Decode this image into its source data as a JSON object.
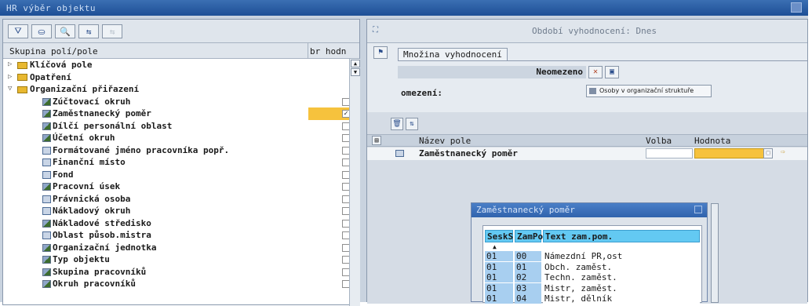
{
  "window": {
    "title": "HR výběr objektu"
  },
  "left": {
    "toolbar": [
      "⛛",
      "⛀",
      "🔍",
      "⇆",
      "⇆"
    ],
    "header": {
      "col1": "Skupina polí/pole",
      "col2": "br hodn"
    },
    "tree": [
      {
        "level": 0,
        "expand": "▷",
        "label": "Klíčová pole",
        "check": false
      },
      {
        "level": 0,
        "expand": "▷",
        "label": "Opatření",
        "check": false
      },
      {
        "level": 0,
        "expand": "▽",
        "label": "Organizační přiřazení",
        "check": false
      },
      {
        "level": 1,
        "icon": "pen",
        "label": "Zúčtovací okruh",
        "check": false
      },
      {
        "level": 1,
        "icon": "pen",
        "label": "Zaměstnanecký poměr",
        "check": true,
        "highlight": true
      },
      {
        "level": 1,
        "icon": "pen",
        "label": "Dílčí personální oblast",
        "check": false
      },
      {
        "level": 1,
        "icon": "pen",
        "label": "Účetní okruh",
        "check": false
      },
      {
        "level": 1,
        "icon": "fld",
        "label": "Formátované jméno pracovníka popř.",
        "check": false
      },
      {
        "level": 1,
        "icon": "fld",
        "label": "Finanční místo",
        "check": false
      },
      {
        "level": 1,
        "icon": "fld",
        "label": "Fond",
        "check": false
      },
      {
        "level": 1,
        "icon": "pen",
        "label": "Pracovní úsek",
        "check": false
      },
      {
        "level": 1,
        "icon": "fld",
        "label": "Právnická osoba",
        "check": false
      },
      {
        "level": 1,
        "icon": "fld",
        "label": "Nákladový okruh",
        "check": false
      },
      {
        "level": 1,
        "icon": "pen",
        "label": "Nákladové středisko",
        "check": false
      },
      {
        "level": 1,
        "icon": "fld",
        "label": "Oblast působ.mistra",
        "check": false
      },
      {
        "level": 1,
        "icon": "pen",
        "label": "Organizační jednotka",
        "check": false
      },
      {
        "level": 1,
        "icon": "pen",
        "label": "Typ objektu",
        "check": false
      },
      {
        "level": 1,
        "icon": "pen",
        "label": "Skupina pracovníků",
        "check": false
      },
      {
        "level": 1,
        "icon": "pen",
        "label": "Okruh pracovníků",
        "check": false
      }
    ]
  },
  "right": {
    "title": "Období vyhodnocení: Dnes",
    "set_tab": "Množina vyhodnocení",
    "neomezeno": "Neomezeno",
    "omezeni_label": "omezení:",
    "osoby_button": "Osoby v organizační struktuře",
    "table": {
      "headers": [
        "Název pole",
        "Volba",
        "Hodnota"
      ],
      "row_name": "Zaměstnanecký poměr"
    }
  },
  "popup": {
    "title": "Zaměstnanecký poměr",
    "headers": [
      "SeskS",
      "ZamPo",
      "Text zam.pom."
    ],
    "sort_indicator": "▲",
    "rows": [
      [
        "01",
        "00",
        "Námezdní PR,ost"
      ],
      [
        "01",
        "01",
        "Obch. zaměst."
      ],
      [
        "01",
        "02",
        "Techn. zaměst."
      ],
      [
        "01",
        "03",
        "Mistr, zaměst."
      ],
      [
        "01",
        "04",
        "Mistr, dělník"
      ]
    ]
  }
}
